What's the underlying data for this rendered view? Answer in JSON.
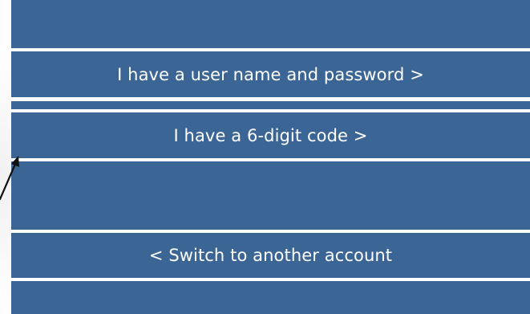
{
  "options": {
    "password_label": "I have a user name and password >",
    "code_label": "I have a 6-digit code >",
    "switch_label": "< Switch to another account"
  },
  "annotation": {
    "arrow_icon": "pointer-arrow-icon",
    "color": "#111111"
  },
  "colors": {
    "band": "#3b6594",
    "separator": "#ffffff"
  }
}
